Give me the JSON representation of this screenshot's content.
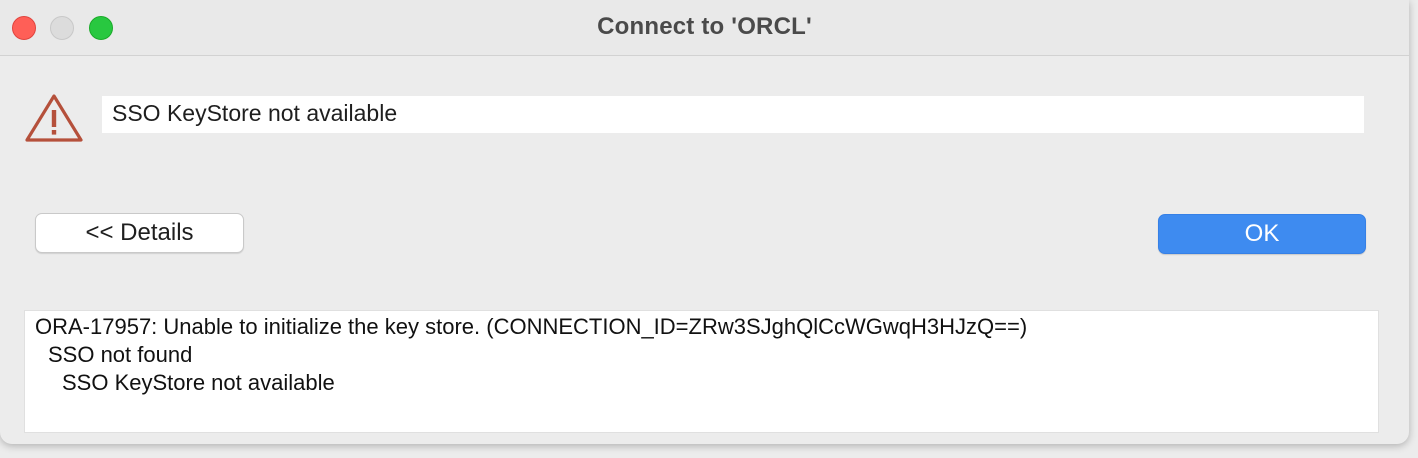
{
  "window": {
    "title": "Connect to 'ORCL'"
  },
  "alert": {
    "icon": "warning-triangle-icon",
    "icon_color": "#b5503b",
    "message": "SSO KeyStore not available"
  },
  "buttons": {
    "details_label": "<< Details",
    "ok_label": "OK",
    "ok_color": "#3e8bf0"
  },
  "details": {
    "lines": [
      "ORA-17957: Unable to initialize the key store. (CONNECTION_ID=ZRw3SJghQlCcWGwqH3HJzQ==)",
      "SSO not found",
      "SSO KeyStore not available"
    ]
  }
}
